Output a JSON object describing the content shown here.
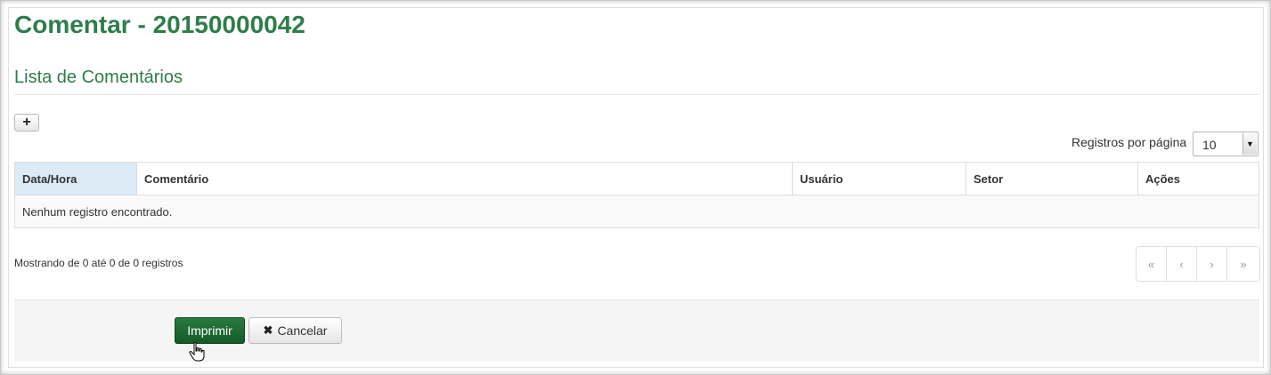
{
  "page": {
    "title": "Comentar - 20150000042"
  },
  "section": {
    "title": "Lista de Comentários"
  },
  "toolbar": {
    "add_icon": "plus-icon",
    "add_glyph": "+"
  },
  "per_page": {
    "label": "Registros por página",
    "value": "10"
  },
  "table": {
    "headers": [
      "Data/Hora",
      "Comentário",
      "Usuário",
      "Setor",
      "Ações"
    ],
    "sorted_column": "Data/Hora",
    "empty_message": "Nenhum registro encontrado."
  },
  "info": {
    "text": "Mostrando de 0 até 0 de 0 registros"
  },
  "pagination": {
    "first": "«",
    "prev": "‹",
    "next": "›",
    "last": "»"
  },
  "actions": {
    "print_label": "Imprimir",
    "cancel_label": "Cancelar",
    "cancel_icon": "times-icon"
  },
  "colors": {
    "brand_green": "#2e7d4a",
    "print_button": "#1f6b33",
    "sorted_header": "#dceaf5"
  }
}
